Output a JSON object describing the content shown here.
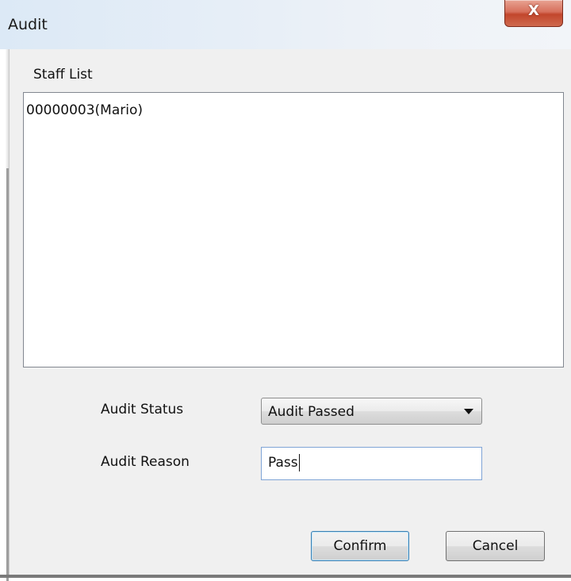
{
  "window": {
    "title": "Audit",
    "close_label": "X"
  },
  "staff_list": {
    "label": "Staff List",
    "items": [
      "00000003(Mario)"
    ]
  },
  "audit_status": {
    "label": "Audit Status",
    "selected": "Audit Passed"
  },
  "audit_reason": {
    "label": "Audit Reason",
    "value": "Pass"
  },
  "buttons": {
    "confirm": "Confirm",
    "cancel": "Cancel"
  },
  "colors": {
    "close_button": "#c2462c",
    "dialog_background": "#f0f0f0",
    "focus_border": "#3c7fb1"
  }
}
